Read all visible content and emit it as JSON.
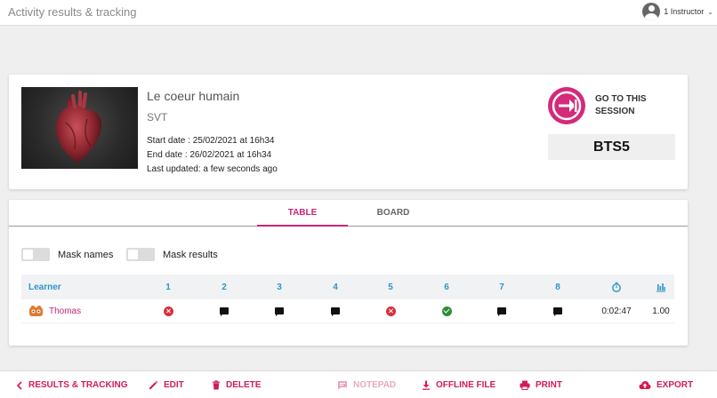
{
  "header": {
    "title": "Activity results & tracking",
    "user_label": "1 Instructor"
  },
  "session": {
    "title": "Le coeur humain",
    "subject": "SVT",
    "start_date": "Start date : 25/02/2021 at 16h34",
    "end_date": "End date : 26/02/2021 at 16h34",
    "last_updated": "Last updated: a few seconds ago",
    "goto_line1": "GO TO THIS",
    "goto_line2": "SESSION",
    "code": "BTS5",
    "accent_color": "#d5297a"
  },
  "tabs": {
    "table": "TABLE",
    "board": "BOARD",
    "active": "TABLE"
  },
  "toggles": {
    "mask_names": {
      "label": "Mask names",
      "on": false
    },
    "mask_results": {
      "label": "Mask results",
      "on": false
    }
  },
  "table": {
    "headers": {
      "learner": "Learner",
      "questions": [
        "1",
        "2",
        "3",
        "4",
        "5",
        "6",
        "7",
        "8"
      ],
      "time_icon": "stopwatch-icon",
      "score_icon": "bar-chart-icon"
    },
    "rows": [
      {
        "learner": "Thomas",
        "avatar_icon": "avatar-icon",
        "results": [
          "wrong",
          "pending",
          "pending",
          "pending",
          "wrong",
          "correct",
          "pending",
          "pending"
        ],
        "time": "0:02:47",
        "score": "1.00"
      }
    ]
  },
  "footer": {
    "results_tracking": "RESULTS & TRACKING",
    "edit": "EDIT",
    "delete": "DELETE",
    "notepad": "NOTEPAD",
    "offline_file": "OFFLINE FILE",
    "print": "PRINT",
    "export": "EXPORT"
  }
}
